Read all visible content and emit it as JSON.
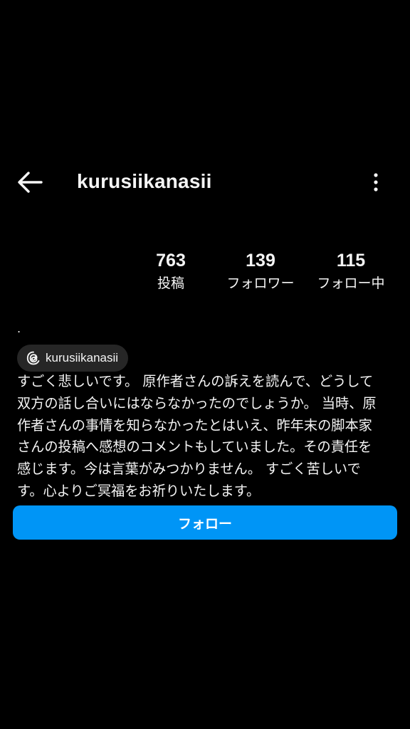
{
  "header": {
    "back_icon": "arrow-left-icon",
    "username": "kurusiikanasii",
    "more_icon": "more-vertical-icon"
  },
  "stats": {
    "posts": {
      "value": "763",
      "label": "投稿"
    },
    "followers": {
      "value": "139",
      "label": "フォロワー"
    },
    "following": {
      "value": "115",
      "label": "フォロー中"
    }
  },
  "profile": {
    "name_line": ".",
    "threads_icon": "threads-icon",
    "threads_handle": "kurusiikanasii",
    "bio": "すごく悲しいです。 原作者さんの訴えを読んで、どうして\n双方の話し合いにはならなかったのでしょうか。 当時、原\n作者さんの事情を知らなかったとはいえ、昨年末の脚本家\nさんの投稿へ感想のコメントもしていました。その責任を\n感じます。今は言葉がみつかりません。 すごく苦しいで\nす。心よりご冥福をお祈りいたします。"
  },
  "actions": {
    "follow_label": "フォロー"
  },
  "colors": {
    "background": "#000000",
    "text": "#f5f5f5",
    "chip": "#262626",
    "accent": "#0095f6"
  }
}
